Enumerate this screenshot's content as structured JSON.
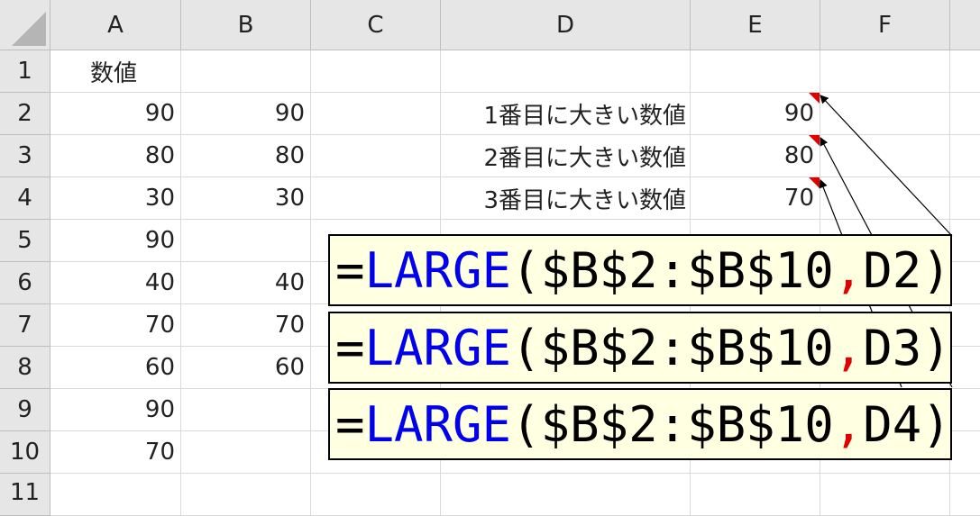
{
  "columns": [
    "A",
    "B",
    "C",
    "D",
    "E",
    "F"
  ],
  "rows": [
    "1",
    "2",
    "3",
    "4",
    "5",
    "6",
    "7",
    "8",
    "9",
    "10",
    "11"
  ],
  "cells": {
    "A1": "数値",
    "A2": "90",
    "A3": "80",
    "A4": "30",
    "A5": "90",
    "A6": "40",
    "A7": "70",
    "A8": "60",
    "A9": "90",
    "A10": "70",
    "B2": "90",
    "B3": "80",
    "B4": "30",
    "B6": "40",
    "B7": "70",
    "B8": "60",
    "D2": "1番目に大きい数値",
    "D3": "2番目に大きい数値",
    "D4": "3番目に大きい数値",
    "E2": "90",
    "E3": "80",
    "E4": "70"
  },
  "formulas": [
    {
      "eq": "=",
      "fn": "LARGE",
      "open": "(",
      "range": "$B$2:$B$10",
      "comma": ",",
      "arg": " D2",
      "close": ")"
    },
    {
      "eq": "=",
      "fn": "LARGE",
      "open": "(",
      "range": "$B$2:$B$10",
      "comma": ",",
      "arg": " D3",
      "close": ")"
    },
    {
      "eq": "=",
      "fn": "LARGE",
      "open": "(",
      "range": "$B$2:$B$10",
      "comma": ",",
      "arg": " D4",
      "close": ")"
    }
  ],
  "colors": {
    "function": "#0000ee",
    "comma": "#e00000",
    "comment_marker": "#e00000",
    "note_bg": "#ffffe1"
  }
}
